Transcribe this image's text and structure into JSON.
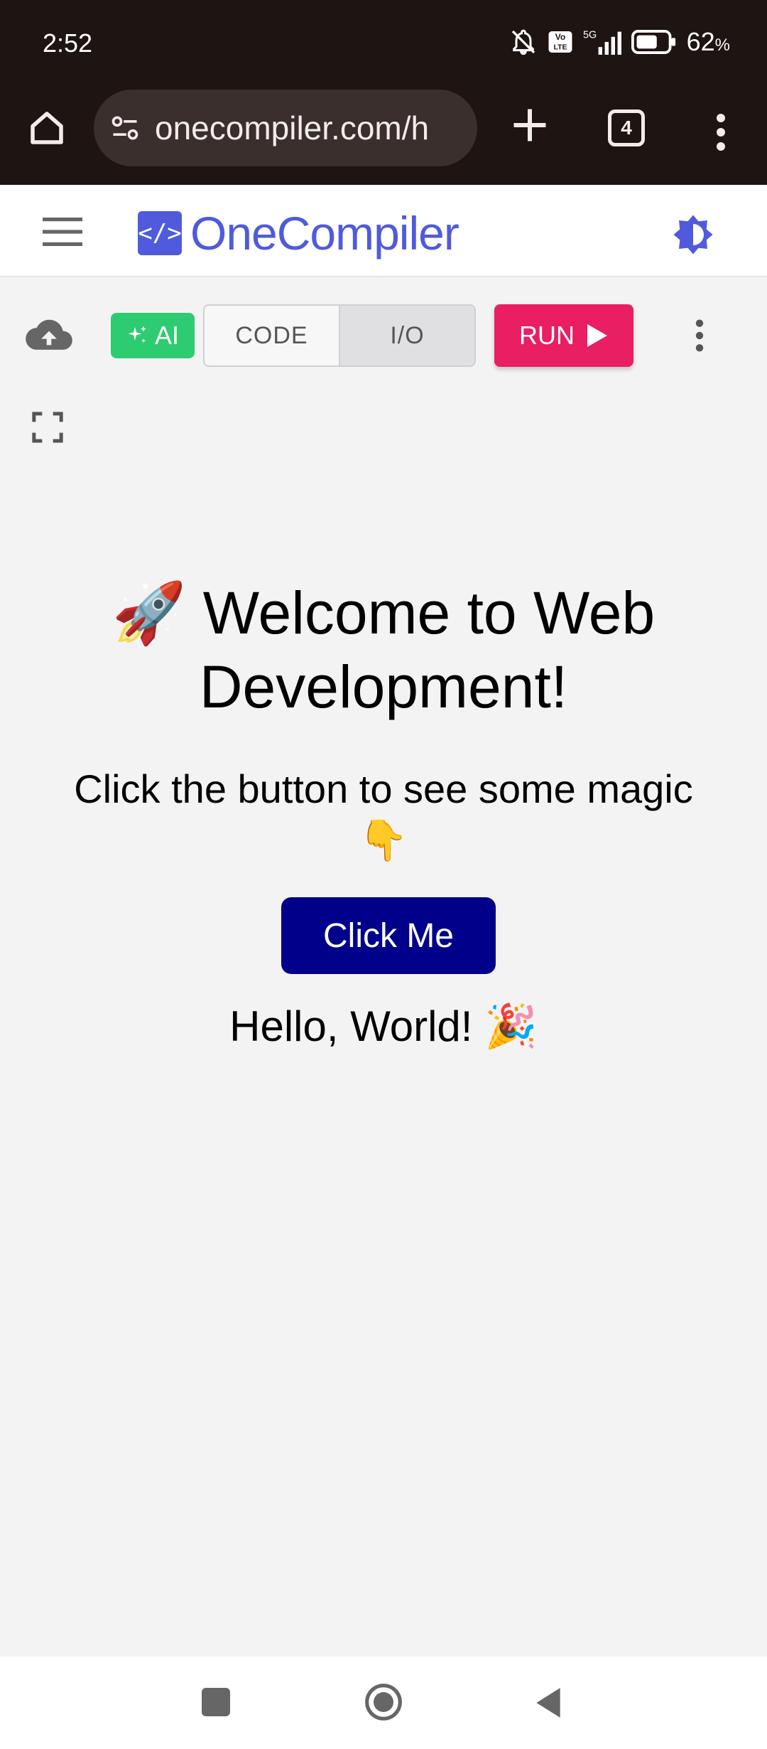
{
  "status_bar": {
    "time": "2:52",
    "battery_value": "62",
    "battery_unit": "%",
    "network": "5G",
    "volte": "Vo LTE"
  },
  "browser": {
    "url": "onecompiler.com/h",
    "tab_count": "4"
  },
  "app_header": {
    "logo_mark": "</>",
    "logo_text": "OneCompiler",
    "brand_color": "#4f5bdc"
  },
  "toolbar": {
    "ai_label": "AI",
    "tabs": [
      {
        "label": "CODE",
        "active": false
      },
      {
        "label": "I/O",
        "active": true
      }
    ],
    "run_label": "RUN",
    "run_color": "#e91e63",
    "ai_color": "#2ecc71"
  },
  "output": {
    "title": "🚀 Welcome to Web Development!",
    "subtitle": "Click the button to see some magic 👇",
    "button_label": "Click Me",
    "button_color": "#00008b",
    "message": "Hello, World! 🎉"
  },
  "icons": {
    "home": "home-icon",
    "tune": "site-settings-icon",
    "plus": "new-tab-icon",
    "tabs": "tab-switcher-icon",
    "menu": "more-vert-icon",
    "hamburger": "hamburger-icon",
    "theme": "brightness-icon",
    "cloud": "cloud-upload-icon",
    "sparkle": "sparkle-icon",
    "play": "play-icon",
    "expand": "fullscreen-icon"
  }
}
